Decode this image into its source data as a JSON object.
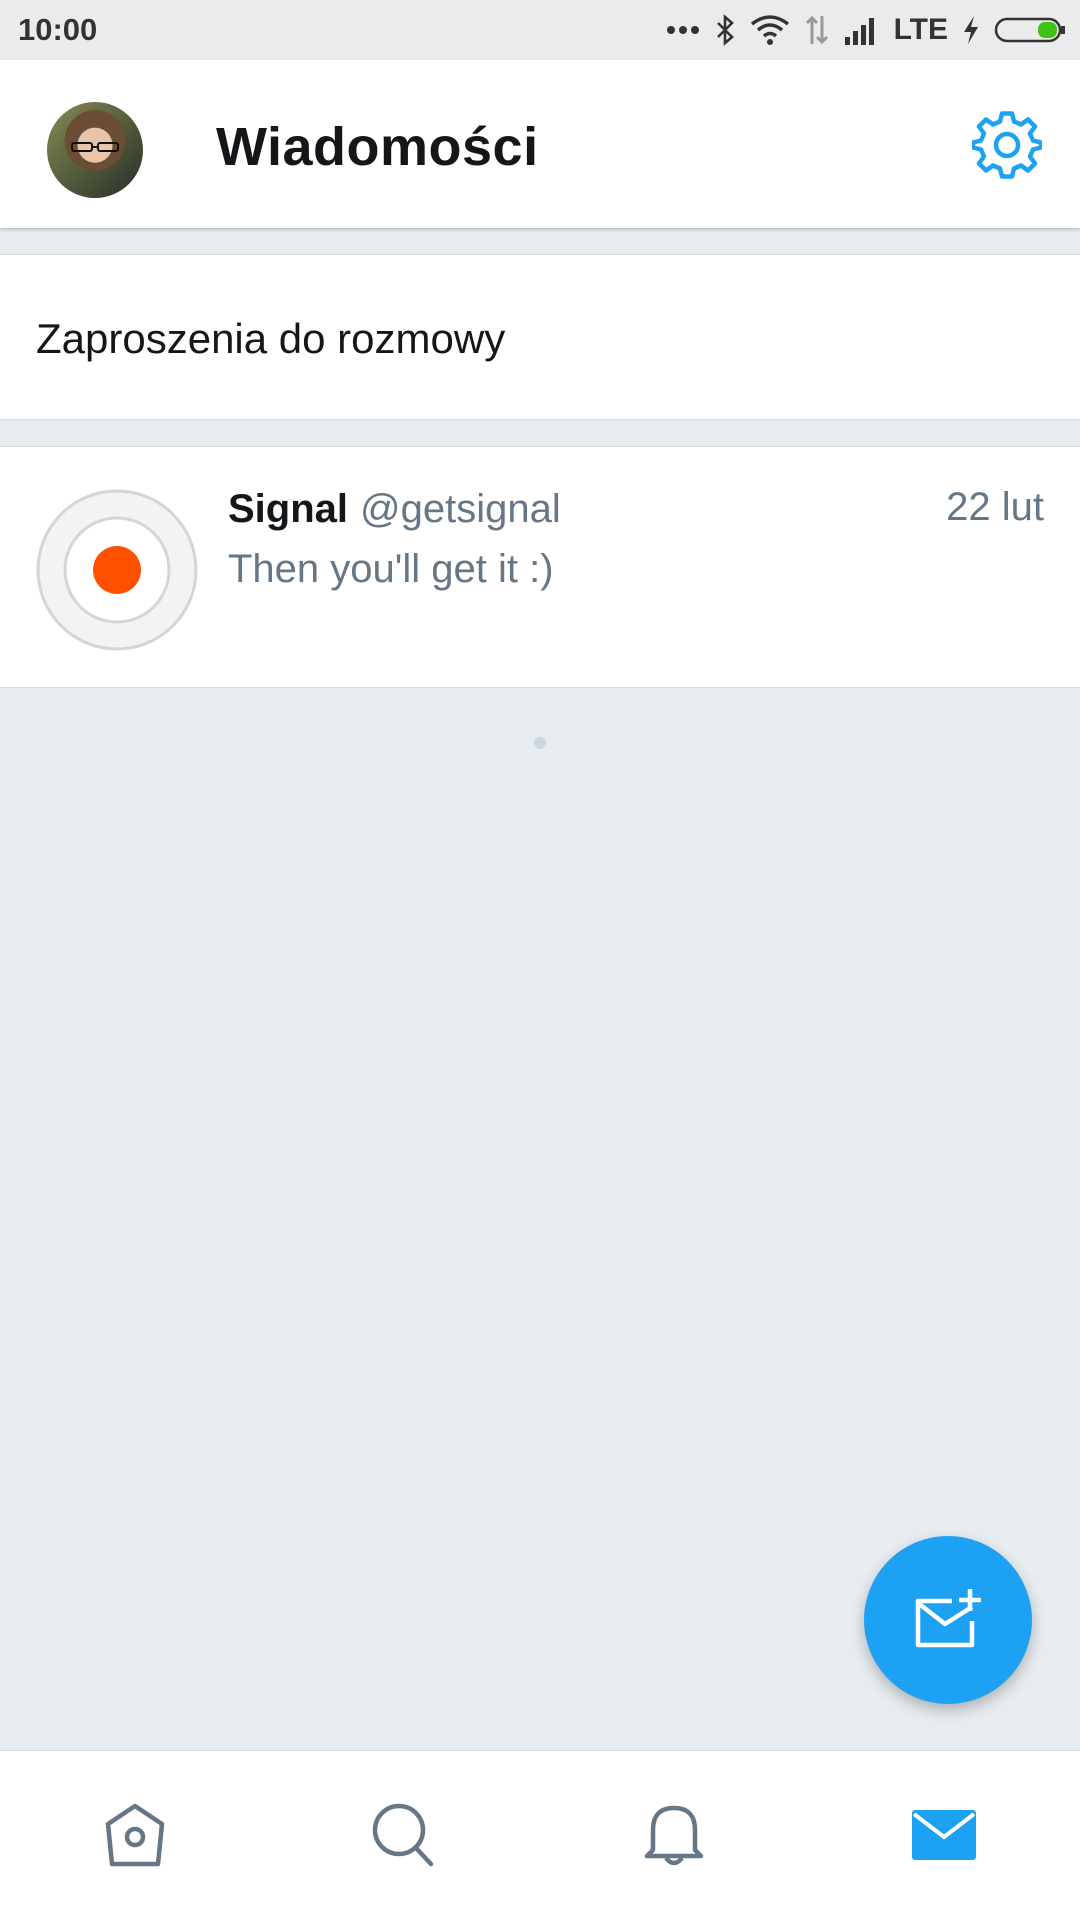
{
  "status_bar": {
    "time": "10:00",
    "network": "LTE",
    "icons": [
      "more-dots-icon",
      "bluetooth-icon",
      "wifi-icon",
      "data-arrows-icon",
      "signal-icon",
      "charging-icon",
      "battery-icon"
    ]
  },
  "header": {
    "title": "Wiadomości",
    "settings_icon": "gear-icon"
  },
  "invites": {
    "label": "Zaproszenia do rozmowy"
  },
  "conversations": [
    {
      "name": "Signal",
      "handle": "@getsignal",
      "date": "22 lut",
      "preview": "Then you'll get it :)"
    }
  ],
  "fab": {
    "icon": "new-message-icon"
  },
  "bottom_nav": {
    "items": [
      {
        "icon": "home-icon",
        "active": false
      },
      {
        "icon": "search-icon",
        "active": false
      },
      {
        "icon": "bell-icon",
        "active": false
      },
      {
        "icon": "mail-icon",
        "active": true
      }
    ]
  },
  "colors": {
    "accent": "#1da1f2",
    "secondary_text": "#657786",
    "background": "#e6ecf0",
    "signal_orange": "#ff5000",
    "battery_green": "#3ec213"
  }
}
